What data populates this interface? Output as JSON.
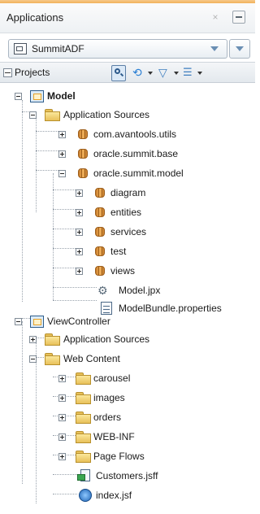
{
  "header": {
    "title": "Applications",
    "close_glyph": "×"
  },
  "app_selector": {
    "value": "SummitADF"
  },
  "projects_bar": {
    "label": "Projects"
  },
  "tree": {
    "model": "Model",
    "model_app_sources": "Application Sources",
    "pkg_avantools": "com.avantools.utils",
    "pkg_summit_base": "oracle.summit.base",
    "pkg_summit_model": "oracle.summit.model",
    "sub_diagram": "diagram",
    "sub_entities": "entities",
    "sub_services": "services",
    "sub_test": "test",
    "sub_views": "views",
    "file_model_jpx": "Model.jpx",
    "file_bundle": "ModelBundle.properties",
    "viewcontroller": "ViewController",
    "vc_app_sources": "Application Sources",
    "web_content": "Web Content",
    "wc_carousel": "carousel",
    "wc_images": "images",
    "wc_orders": "orders",
    "wc_webinf": "WEB-INF",
    "wc_pageflows": "Page Flows",
    "file_customers": "Customers.jsff",
    "file_index": "index.jsf"
  }
}
